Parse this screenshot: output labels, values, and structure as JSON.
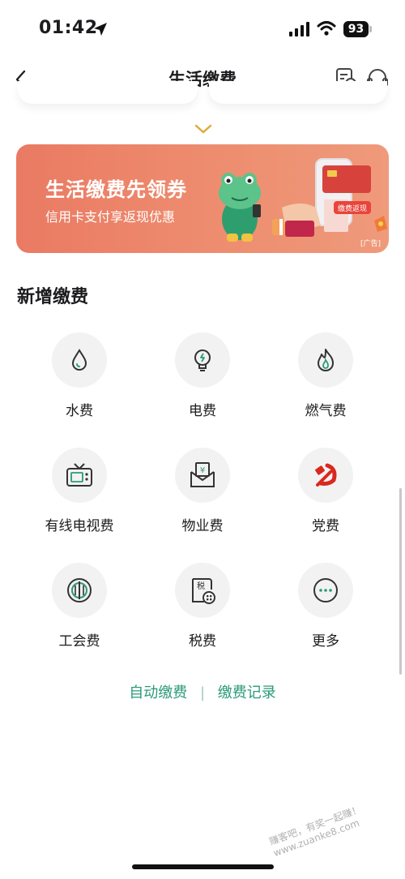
{
  "status_bar": {
    "time": "01:42",
    "battery": "93"
  },
  "nav": {
    "title": "生活缴费"
  },
  "banner": {
    "title": "生活缴费先领券",
    "subtitle": "信用卡支付享返现优惠",
    "badge": "缴费返现",
    "ad_tag": "[广告]"
  },
  "section": {
    "title": "新增缴费"
  },
  "items": [
    {
      "label": "水费",
      "icon": "water-drop-icon"
    },
    {
      "label": "电费",
      "icon": "lightbulb-icon"
    },
    {
      "label": "燃气费",
      "icon": "flame-icon"
    },
    {
      "label": "有线电视费",
      "icon": "tv-icon"
    },
    {
      "label": "物业费",
      "icon": "envelope-yuan-icon"
    },
    {
      "label": "党费",
      "icon": "party-emblem-icon"
    },
    {
      "label": "工会费",
      "icon": "union-emblem-icon"
    },
    {
      "label": "税费",
      "icon": "tax-icon"
    },
    {
      "label": "更多",
      "icon": "more-icon"
    }
  ],
  "links": {
    "auto_pay": "自动缴费",
    "separator": "|",
    "history": "缴费记录"
  },
  "watermark": "赚客吧，有奖一起赚！ www.zuanke8.com",
  "colors": {
    "accent_green": "#2b9a78",
    "banner_start": "#ea7a63",
    "party_red": "#d9281e"
  }
}
